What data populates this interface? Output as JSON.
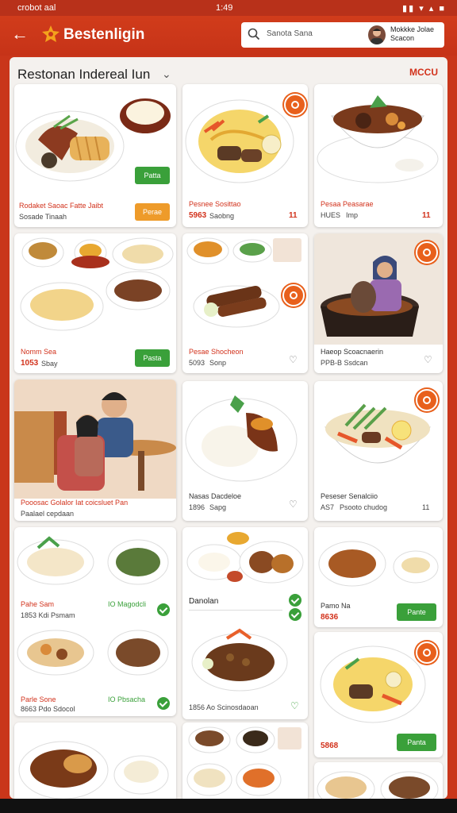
{
  "status": {
    "left": "crobot aal",
    "time": "1:49",
    "right": "▮▮ ▾ ▴ ■"
  },
  "app": {
    "title": "Bestenligin"
  },
  "search": {
    "placeholder": "Sanota Sana",
    "user": "Mokkke Jolae Scacon"
  },
  "panel": {
    "title": "Restonan Indereal Iun",
    "menu": "MCCU"
  },
  "cards": {
    "c1": {
      "name": "Rodaket Saoac Fatte Jaibt",
      "sub": "Sosade Tinaah",
      "btn1": "Patta",
      "btn2": "Perae"
    },
    "c2": {
      "name": "Pesnee Sosittao",
      "price": "5963",
      "sub": "Saobng",
      "rating": "11"
    },
    "c3": {
      "name": "Pesaa Peasarae",
      "price": "HUES",
      "sub": "Imp",
      "rating": "11"
    },
    "c4": {
      "name": "Nomm Sea",
      "price": "1053",
      "sub": "Sbay",
      "btn": "Pasta"
    },
    "c5": {
      "name": "Pesae Shocheon",
      "price": "5093",
      "sub": "Sonp"
    },
    "c6": {
      "name": "Haeop Scoacnaerin",
      "sub": "PPB-B Ssdcan"
    },
    "c7": {
      "name": "Pooosac Golalor Iat coicsluet Pan",
      "sub": "Paalael cepdaan"
    },
    "c8": {
      "name": "Nasas Dacdeloe",
      "price": "1896",
      "sub": "Sapg"
    },
    "c9": {
      "name": "Peseser Senalciio",
      "price": "AS7",
      "sub": "Psooto chudog",
      "rating": "11"
    },
    "c10": {
      "r1name": "Pahe Sam",
      "r1sub": "1853 Kdi Psmam",
      "r1tag": "IO Magodcli",
      "r2name": "Parle Sone",
      "r2sub": "8663 Pdo Sdocol",
      "r2tag": "IO Pbsacha"
    },
    "c11": {
      "name": "Danolan",
      "sub": "1856 Ao Scinosdaoan"
    },
    "c12": {
      "name": "Pamo Na",
      "price": "8636",
      "btn": "Pante"
    },
    "c13": {
      "price": "5868",
      "btn": "Panta"
    }
  },
  "colors": {
    "brand": "#c9361a",
    "accent": "#d2321c",
    "button": "#3aa03a"
  }
}
